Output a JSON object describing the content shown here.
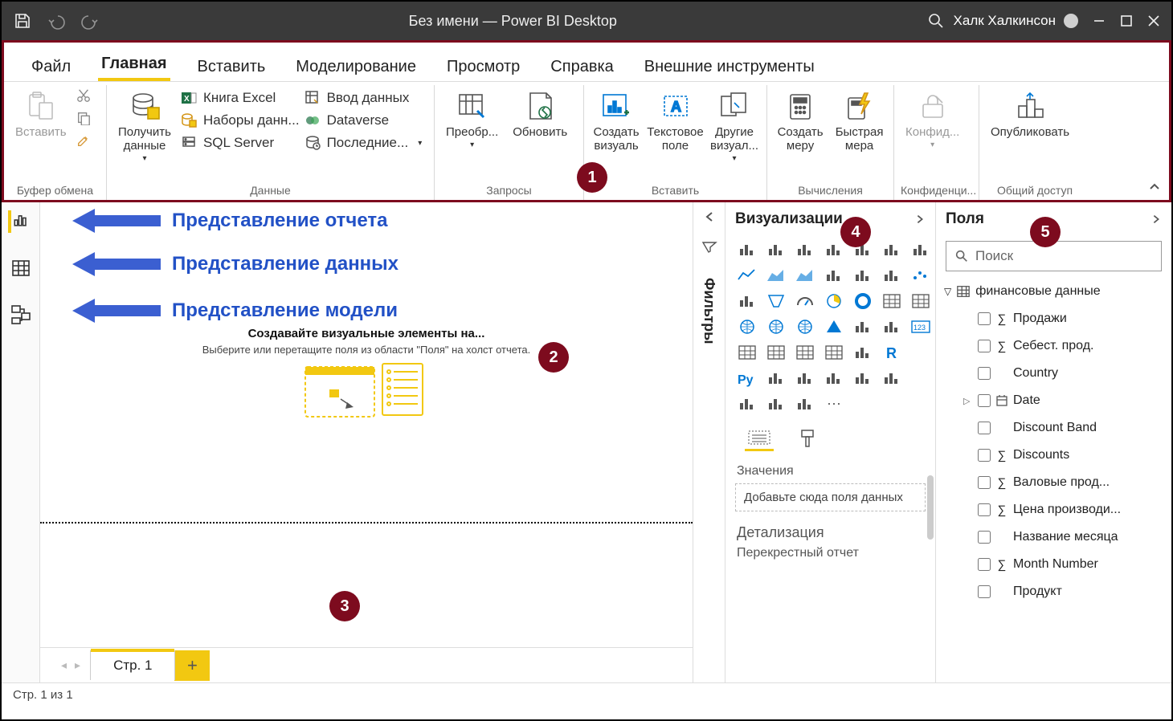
{
  "title": "Без имени — Power BI Desktop",
  "user": "Халк Халкинсон",
  "ribbon_tabs": [
    "Файл",
    "Главная",
    "Вставить",
    "Моделирование",
    "Просмотр",
    "Справка",
    "Внешние инструменты"
  ],
  "ribbon": {
    "clipboard": {
      "paste": "Вставить",
      "label": "Буфер обмена"
    },
    "data": {
      "get": "Получить\nданные",
      "items": [
        "Книга Excel",
        "Наборы данн...",
        "SQL Server",
        "Ввод данных",
        "Dataverse",
        "Последние... "
      ],
      "label": "Данные"
    },
    "queries": {
      "transform": "Преобр...",
      "refresh": "Обновить",
      "label": "Запросы"
    },
    "insert": {
      "visual": "Создать\nвизуаль",
      "textbox": "Текстовое\nполе",
      "more": "Другие\nвизуал...",
      "label": "Вставить"
    },
    "calc": {
      "measure": "Создать\nмеру",
      "quick": "Быстрая\nмера",
      "label": "Вычисления"
    },
    "sens": {
      "btn": "Конфид...",
      "label": "Конфиденци..."
    },
    "share": {
      "publish": "Опубликовать",
      "label": "Общий доступ"
    }
  },
  "views": {
    "report": "Представление отчета",
    "data": "Представление данных",
    "model": "Представление модели"
  },
  "canvas": {
    "title": "Создавайте визуальные элементы на...",
    "hint": "Выберите или перетащите поля из области \"Поля\" на холст отчета."
  },
  "pages": {
    "tab": "Стр. 1"
  },
  "filters_label": "Фильтры",
  "viz": {
    "title": "Визуализации",
    "values": "Значения",
    "drop": "Добавьте сюда поля данных",
    "drill": "Детализация",
    "cross": "Перекрестный отчет"
  },
  "fields": {
    "title": "Поля",
    "search": "Поиск",
    "table": "финансовые данные",
    "items": [
      {
        "name": "Продажи",
        "sigma": true
      },
      {
        "name": "Себест. прод.",
        "sigma": true
      },
      {
        "name": "Country",
        "sigma": false
      },
      {
        "name": "Date",
        "sigma": false,
        "expandable": true,
        "calendar": true
      },
      {
        "name": "Discount Band",
        "sigma": false
      },
      {
        "name": "Discounts",
        "sigma": true
      },
      {
        "name": "Валовые прод...",
        "sigma": true
      },
      {
        "name": "Цена производи...",
        "sigma": true
      },
      {
        "name": "Название месяца",
        "sigma": false
      },
      {
        "name": "Month Number",
        "sigma": true
      },
      {
        "name": "Продукт",
        "sigma": false
      }
    ]
  },
  "status": "Стр. 1 из 1",
  "badges": [
    "1",
    "2",
    "3",
    "4",
    "5"
  ]
}
